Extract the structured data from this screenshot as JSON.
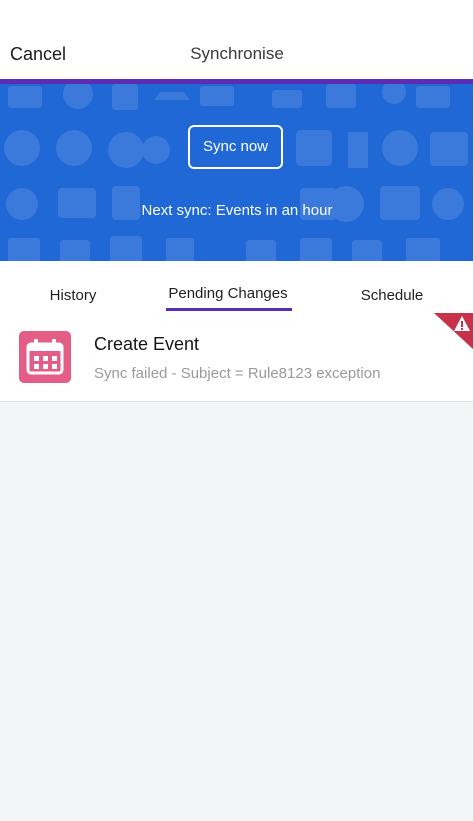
{
  "nav": {
    "cancel_label": "Cancel",
    "title": "Synchronise"
  },
  "hero": {
    "sync_button_label": "Sync now",
    "next_sync_text": "Next sync: Events in an hour",
    "background_color": "#1f68d6",
    "accent_color": "#5b2db5"
  },
  "tabs": [
    {
      "label": "History",
      "active": false
    },
    {
      "label": "Pending Changes",
      "active": true
    },
    {
      "label": "Schedule",
      "active": false
    }
  ],
  "pending_items": [
    {
      "title": "Create Event",
      "subtitle": "Sync failed - Subject = Rule8123 exception",
      "icon": "calendar-icon",
      "icon_color": "#e35d86",
      "status": "error",
      "status_icon": "warning-icon",
      "status_color": "#c7324a"
    }
  ]
}
